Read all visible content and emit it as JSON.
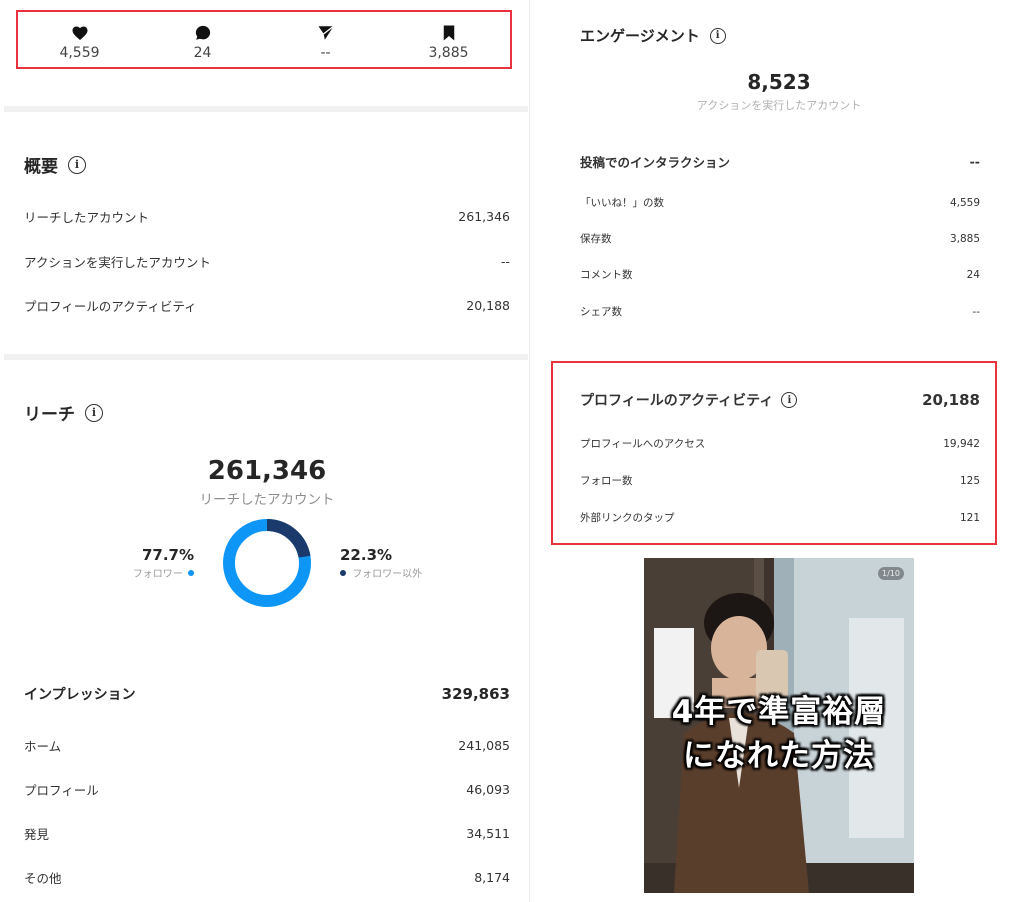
{
  "stats": {
    "likes": "4,559",
    "comments": "24",
    "shares": "--",
    "saves": "3,885"
  },
  "overview": {
    "title": "概要",
    "rows": [
      {
        "label": "リーチしたアカウント",
        "value": "261,346"
      },
      {
        "label": "アクションを実行したアカウント",
        "value": "--"
      },
      {
        "label": "プロフィールのアクティビティ",
        "value": "20,188"
      }
    ]
  },
  "reach": {
    "title": "リーチ",
    "total": "261,346",
    "total_label": "リーチしたアカウント",
    "followers_pct": "77.7%",
    "followers_label": "フォロワー",
    "nonfollowers_pct": "22.3%",
    "nonfollowers_label": "フォロワー以外",
    "followers_fraction": 0.777,
    "colors": {
      "followers": "#0d96f6",
      "nonfollowers": "#1a3a6b"
    }
  },
  "impressions": {
    "title": "インプレッション",
    "total": "329,863",
    "rows": [
      {
        "label": "ホーム",
        "value": "241,085"
      },
      {
        "label": "プロフィール",
        "value": "46,093"
      },
      {
        "label": "発見",
        "value": "34,511"
      },
      {
        "label": "その他",
        "value": "8,174"
      }
    ]
  },
  "engagement": {
    "title": "エンゲージメント",
    "total": "8,523",
    "total_label": "アクションを実行したアカウント",
    "interactions_title": "投稿でのインタラクション",
    "interactions_value": "--",
    "rows": [
      {
        "label": "「いいね！」の数",
        "value": "4,559"
      },
      {
        "label": "保存数",
        "value": "3,885"
      },
      {
        "label": "コメント数",
        "value": "24"
      },
      {
        "label": "シェア数",
        "value": "--"
      }
    ]
  },
  "profile_activity": {
    "title": "プロフィールのアクティビティ",
    "total": "20,188",
    "rows": [
      {
        "label": "プロフィールへのアクセス",
        "value": "19,942"
      },
      {
        "label": "フォロー数",
        "value": "125"
      },
      {
        "label": "外部リンクのタップ",
        "value": "121"
      }
    ]
  },
  "post": {
    "caption_line1": "4年で準富裕層",
    "caption_line2": "になれた方法",
    "page_indicator": "1/10"
  },
  "icons": {
    "info": "i"
  }
}
